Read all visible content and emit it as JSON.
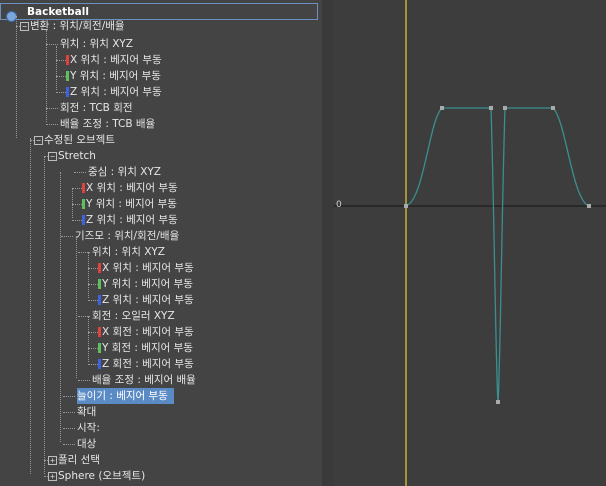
{
  "tree": {
    "root_label": "Backetball",
    "items": [
      {
        "label": "변환 : 위치/회전/배율",
        "expander": "⊟"
      },
      {
        "label": "위치 : 위치 XYZ"
      },
      {
        "label": "X 위치 : 베지어 부동",
        "axis": "x"
      },
      {
        "label": "Y 위치 : 베지어 부동",
        "axis": "y"
      },
      {
        "label": "Z 위치 : 베지어 부동",
        "axis": "z"
      },
      {
        "label": "회전 : TCB 회전"
      },
      {
        "label": "배율 조정 : TCB 배율"
      },
      {
        "label": "수정된 오브젝트",
        "expander": "⊟"
      },
      {
        "label": "Stretch",
        "expander": "⊟"
      },
      {
        "label": "중심 : 위치 XYZ"
      },
      {
        "label": "X 위치 : 베지어 부동",
        "axis": "x"
      },
      {
        "label": "Y 위치 : 베지어 부동",
        "axis": "y"
      },
      {
        "label": "Z 위치 : 베지어 부동",
        "axis": "z"
      },
      {
        "label": "기즈모 : 위치/회전/배율"
      },
      {
        "label": "위치 : 위치 XYZ"
      },
      {
        "label": "X 위치 : 베지어 부동",
        "axis": "x"
      },
      {
        "label": "Y 위치 : 베지어 부동",
        "axis": "y"
      },
      {
        "label": "Z 위치 : 베지어 부동",
        "axis": "z"
      },
      {
        "label": "회전 : 오일러 XYZ"
      },
      {
        "label": "X 회전 : 베지어 부동",
        "axis": "x"
      },
      {
        "label": "Y 회전 : 베지어 부동",
        "axis": "y"
      },
      {
        "label": "Z 회전 : 베지어 부동",
        "axis": "z"
      },
      {
        "label": "배율 조정 : 베지어 배율"
      },
      {
        "label": "늘이기 : 베지어 부동",
        "selected": true
      },
      {
        "label": "확대"
      },
      {
        "label": "시작:"
      },
      {
        "label": "대상"
      },
      {
        "label": "폴리 선택",
        "expander": "⊞"
      },
      {
        "label": "Sphere (오브젝트)",
        "expander": "⊞"
      }
    ]
  },
  "graph": {
    "zero_label": "0",
    "curve_color": "#3c8f8f",
    "key_color": "#aaaaaa",
    "frame_line_color": "#c9b13a",
    "axis_colors": {
      "x": "#e04040",
      "y": "#5cc05c",
      "z": "#4060e0"
    }
  }
}
